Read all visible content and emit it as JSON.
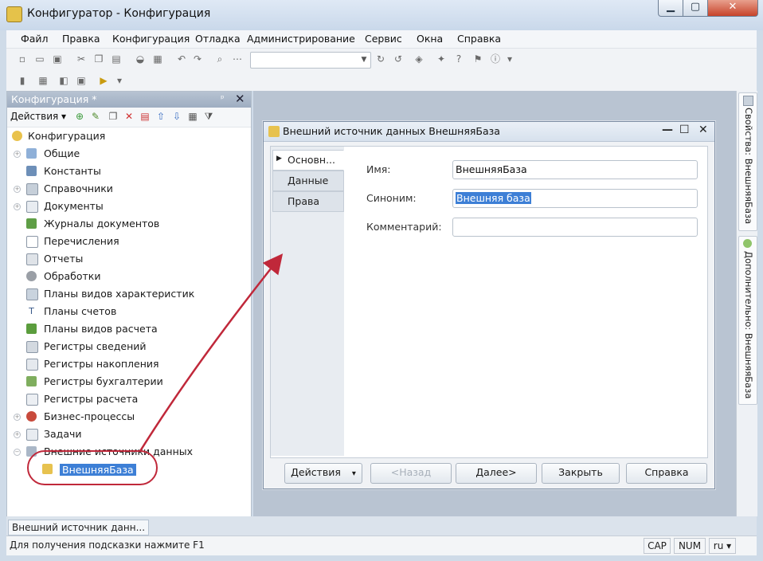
{
  "window": {
    "title": "Конфигуратор - Конфигурация",
    "min_icon": "minimize-icon",
    "max_icon": "maximize-icon",
    "close_icon": "close-icon"
  },
  "menu": [
    "Файл",
    "Правка",
    "Конфигурация",
    "Отладка",
    "Администрирование",
    "Сервис",
    "Окна",
    "Справка"
  ],
  "left_panel": {
    "title": "Конфигурация *",
    "pin": "ᵖ",
    "close": "✕",
    "actions_label": "Действия ▾",
    "tree": {
      "root": "Конфигурация",
      "items": [
        "Общие",
        "Константы",
        "Справочники",
        "Документы",
        "Журналы документов",
        "Перечисления",
        "Отчеты",
        "Обработки",
        "Планы видов характеристик",
        "Планы счетов",
        "Планы видов расчета",
        "Регистры сведений",
        "Регистры накопления",
        "Регистры бухгалтерии",
        "Регистры расчета",
        "Бизнес-процессы",
        "Задачи",
        "Внешние источники данных"
      ],
      "selected": "ВнешняяБаза"
    }
  },
  "dialog": {
    "title": "Внешний источник данных ВнешняяБаза",
    "minimize": "—",
    "maximize": "☐",
    "close": "✕",
    "tabs": [
      "Основн...",
      "Данные",
      "Права"
    ],
    "fields": {
      "name_label": "Имя:",
      "name_value": "ВнешняяБаза",
      "synonym_label": "Синоним:",
      "synonym_value": "Внешняя база",
      "comment_label": "Комментарий:",
      "comment_value": ""
    },
    "buttons": {
      "actions": "Действия",
      "actions_arrow": "▾",
      "back": "<Назад",
      "next": "Далее>",
      "close": "Закрыть",
      "help": "Справка"
    }
  },
  "sidebar_tabs": [
    "Свойства: ВнешняяБаза",
    "Дополнительно: ВнешняяБаза"
  ],
  "taskbar": {
    "item": "Внешний источник данн..."
  },
  "status": {
    "hint": "Для получения подсказки нажмите F1",
    "cap": "CAP",
    "num": "NUM",
    "lang": "ru ▾"
  },
  "colors": {
    "selection": "#3d7fd6",
    "annotation": "#c0283a"
  }
}
